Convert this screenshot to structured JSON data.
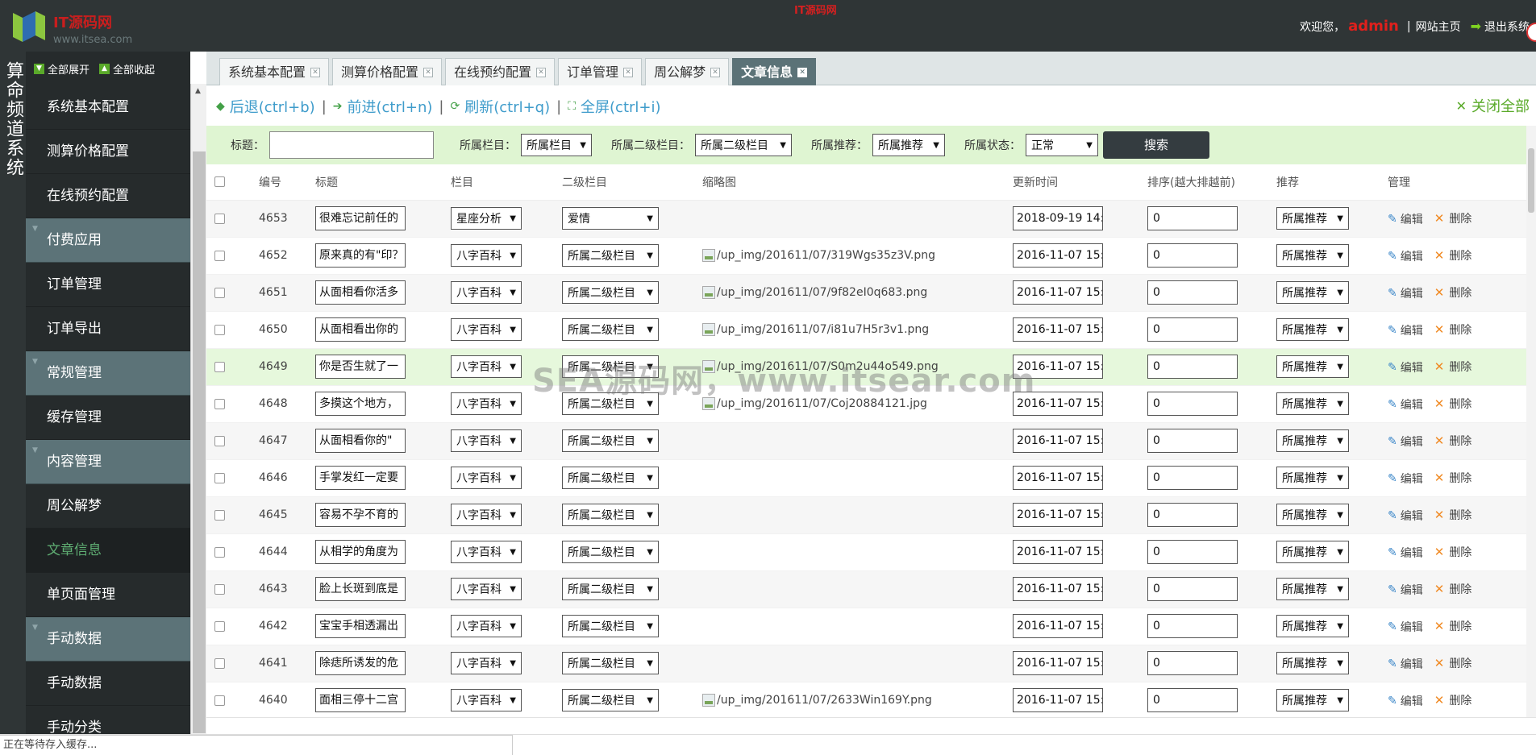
{
  "header": {
    "logo_text": "IT源码网",
    "logo_url": "www.itsea.com",
    "center_text": "IT源码网",
    "welcome": "欢迎您，",
    "username": "admin",
    "site_home": "网站主页",
    "logout": "退出系统"
  },
  "left_title": "算命频道系统",
  "sidebar": {
    "expand_all": "全部展开",
    "collapse_all": "全部收起",
    "items": [
      {
        "type": "item",
        "label": "系统基本配置"
      },
      {
        "type": "item",
        "label": "测算价格配置"
      },
      {
        "type": "item",
        "label": "在线预约配置"
      },
      {
        "type": "group",
        "label": "付费应用"
      },
      {
        "type": "item",
        "label": "订单管理"
      },
      {
        "type": "item",
        "label": "订单导出"
      },
      {
        "type": "group",
        "label": "常规管理"
      },
      {
        "type": "item",
        "label": "缓存管理"
      },
      {
        "type": "group",
        "label": "内容管理"
      },
      {
        "type": "item",
        "label": "周公解梦"
      },
      {
        "type": "item",
        "label": "文章信息",
        "active": true
      },
      {
        "type": "item",
        "label": "单页面管理"
      },
      {
        "type": "group",
        "label": "手动数据"
      },
      {
        "type": "item",
        "label": "手动数据"
      },
      {
        "type": "item",
        "label": "手动分类"
      }
    ]
  },
  "tabs": [
    {
      "label": "系统基本配置"
    },
    {
      "label": "测算价格配置"
    },
    {
      "label": "在线预约配置"
    },
    {
      "label": "订单管理"
    },
    {
      "label": "周公解梦"
    },
    {
      "label": "文章信息",
      "active": true
    }
  ],
  "toolbar": {
    "back": "后退(ctrl+b)",
    "forward": "前进(ctrl+n)",
    "refresh": "刷新(ctrl+q)",
    "fullscreen": "全屏(ctrl+i)",
    "close_all": "关闭全部"
  },
  "search": {
    "title_label": "标题：",
    "title_value": "",
    "column_label": "所属栏目：",
    "column_value": "所属栏目",
    "subcolumn_label": "所属二级栏目：",
    "subcolumn_value": "所属二级栏目",
    "recommend_label": "所属推荐：",
    "recommend_value": "所属推荐",
    "status_label": "所属状态：",
    "status_value": "正常",
    "button": "搜索"
  },
  "table": {
    "headers": [
      "编号",
      "标题",
      "栏目",
      "二级栏目",
      "缩略图",
      "更新时间",
      "排序(越大排越前)",
      "推荐",
      "管理"
    ],
    "edit_label": "编辑",
    "delete_label": "删除",
    "rows": [
      {
        "id": "4653",
        "title": "很难忘记前任的",
        "column": "星座分析",
        "subcolumn": "爱情",
        "thumb": "",
        "time": "2018-09-19 14:",
        "sort": "0",
        "recommend": "所属推荐"
      },
      {
        "id": "4652",
        "title": "原来真的有\"印？",
        "column": "八字百科",
        "subcolumn": "所属二级栏目",
        "thumb": "/up_img/201611/07/319Wgs35z3V.png",
        "time": "2016-11-07 15:",
        "sort": "0",
        "recommend": "所属推荐"
      },
      {
        "id": "4651",
        "title": "从面相看你活多",
        "column": "八字百科",
        "subcolumn": "所属二级栏目",
        "thumb": "/up_img/201611/07/9f82eI0q683.png",
        "time": "2016-11-07 15:",
        "sort": "0",
        "recommend": "所属推荐"
      },
      {
        "id": "4650",
        "title": "从面相看出你的",
        "column": "八字百科",
        "subcolumn": "所属二级栏目",
        "thumb": "/up_img/201611/07/i81u7H5r3v1.png",
        "time": "2016-11-07 15:",
        "sort": "0",
        "recommend": "所属推荐"
      },
      {
        "id": "4649",
        "title": "你是否生就了一",
        "column": "八字百科",
        "subcolumn": "所属二级栏目",
        "thumb": "/up_img/201611/07/S0m2u44o549.png",
        "time": "2016-11-07 15:",
        "sort": "0",
        "recommend": "所属推荐",
        "highlight": true
      },
      {
        "id": "4648",
        "title": "多摸这个地方，",
        "column": "八字百科",
        "subcolumn": "所属二级栏目",
        "thumb": "/up_img/201611/07/Coj20884121.jpg",
        "time": "2016-11-07 15:",
        "sort": "0",
        "recommend": "所属推荐"
      },
      {
        "id": "4647",
        "title": "从面相看你的\"",
        "column": "八字百科",
        "subcolumn": "所属二级栏目",
        "thumb": "",
        "time": "2016-11-07 15:",
        "sort": "0",
        "recommend": "所属推荐"
      },
      {
        "id": "4646",
        "title": "手掌发红一定要",
        "column": "八字百科",
        "subcolumn": "所属二级栏目",
        "thumb": "",
        "time": "2016-11-07 15:",
        "sort": "0",
        "recommend": "所属推荐"
      },
      {
        "id": "4645",
        "title": "容易不孕不育的",
        "column": "八字百科",
        "subcolumn": "所属二级栏目",
        "thumb": "",
        "time": "2016-11-07 15:",
        "sort": "0",
        "recommend": "所属推荐"
      },
      {
        "id": "4644",
        "title": "从相学的角度为",
        "column": "八字百科",
        "subcolumn": "所属二级栏目",
        "thumb": "",
        "time": "2016-11-07 15:",
        "sort": "0",
        "recommend": "所属推荐"
      },
      {
        "id": "4643",
        "title": "脸上长斑到底是",
        "column": "八字百科",
        "subcolumn": "所属二级栏目",
        "thumb": "",
        "time": "2016-11-07 15:",
        "sort": "0",
        "recommend": "所属推荐"
      },
      {
        "id": "4642",
        "title": "宝宝手相透漏出",
        "column": "八字百科",
        "subcolumn": "所属二级栏目",
        "thumb": "",
        "time": "2016-11-07 15:",
        "sort": "0",
        "recommend": "所属推荐"
      },
      {
        "id": "4641",
        "title": "除痣所诱发的危",
        "column": "八字百科",
        "subcolumn": "所属二级栏目",
        "thumb": "",
        "time": "2016-11-07 15:",
        "sort": "0",
        "recommend": "所属推荐"
      },
      {
        "id": "4640",
        "title": "面相三停十二宫",
        "column": "八字百科",
        "subcolumn": "所属二级栏目",
        "thumb": "/up_img/201611/07/2633Win169Y.png",
        "time": "2016-11-07 15:",
        "sort": "0",
        "recommend": "所属推荐"
      }
    ]
  },
  "status_text": "正在等待存入缓存...",
  "watermark": "SEA源码网，www.itsear.com",
  "colors": {
    "header_bg": "#2f3536",
    "sidebar_bg": "#262b2c",
    "group_bg": "#5c7378",
    "active_tab": "#5b7277",
    "search_bg": "#dff5d2",
    "link_blue": "#3f9ccb",
    "accent_green": "#5aaa2a"
  }
}
